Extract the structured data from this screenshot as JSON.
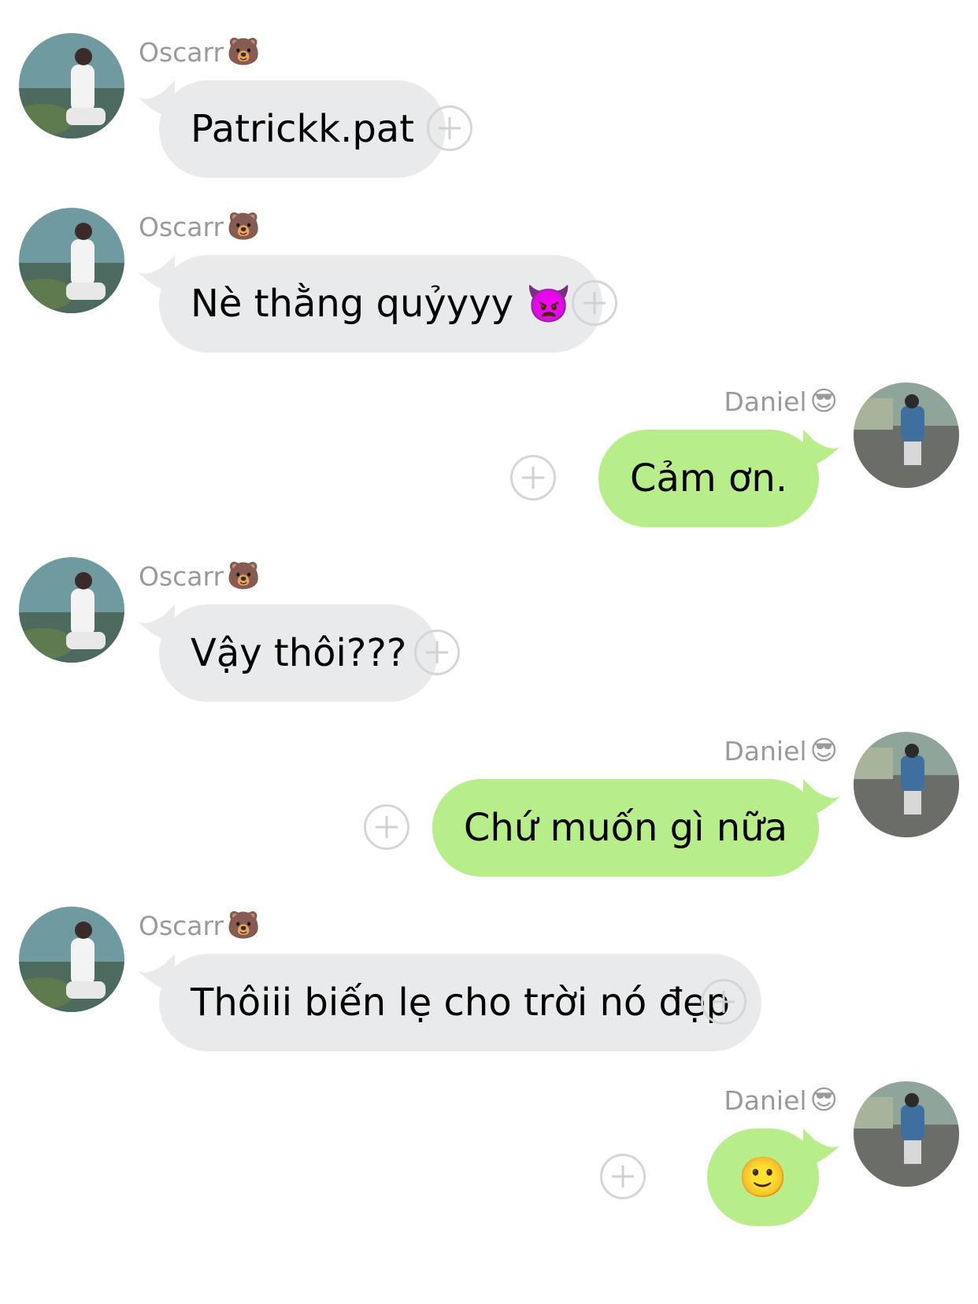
{
  "messages": [
    {
      "sender": "Oscarr",
      "sender_emoji": "🐻",
      "text": "Patrickk.pat",
      "emoji": "",
      "side": "left"
    },
    {
      "sender": "Oscarr",
      "sender_emoji": "🐻",
      "text": "Nè thằng quỷyyy",
      "emoji": "👿",
      "side": "left"
    },
    {
      "sender": "Daniel",
      "sender_emoji": "😎",
      "text": "Cảm ơn.",
      "emoji": "",
      "side": "right"
    },
    {
      "sender": "Oscarr",
      "sender_emoji": "🐻",
      "text": "Vậy thôi???",
      "emoji": "",
      "side": "left"
    },
    {
      "sender": "Daniel",
      "sender_emoji": "😎",
      "text": "Chứ muốn gì nữa",
      "emoji": "",
      "side": "right"
    },
    {
      "sender": "Oscarr",
      "sender_emoji": "🐻",
      "text": "Thôiii biến lẹ cho trời nó đẹp",
      "emoji": "",
      "side": "left"
    },
    {
      "sender": "Daniel",
      "sender_emoji": "😎",
      "text": "",
      "emoji": "🙂",
      "side": "right"
    }
  ],
  "colors": {
    "incoming_bubble": "#e8eaec",
    "outgoing_bubble": "#b7ee89",
    "sender_name": "#9a9a9a",
    "react_button": "#d4d6d8"
  },
  "icons": {
    "react": "add-reaction-icon",
    "avatar_oscarr": "avatar-oscarr",
    "avatar_daniel": "avatar-daniel"
  }
}
